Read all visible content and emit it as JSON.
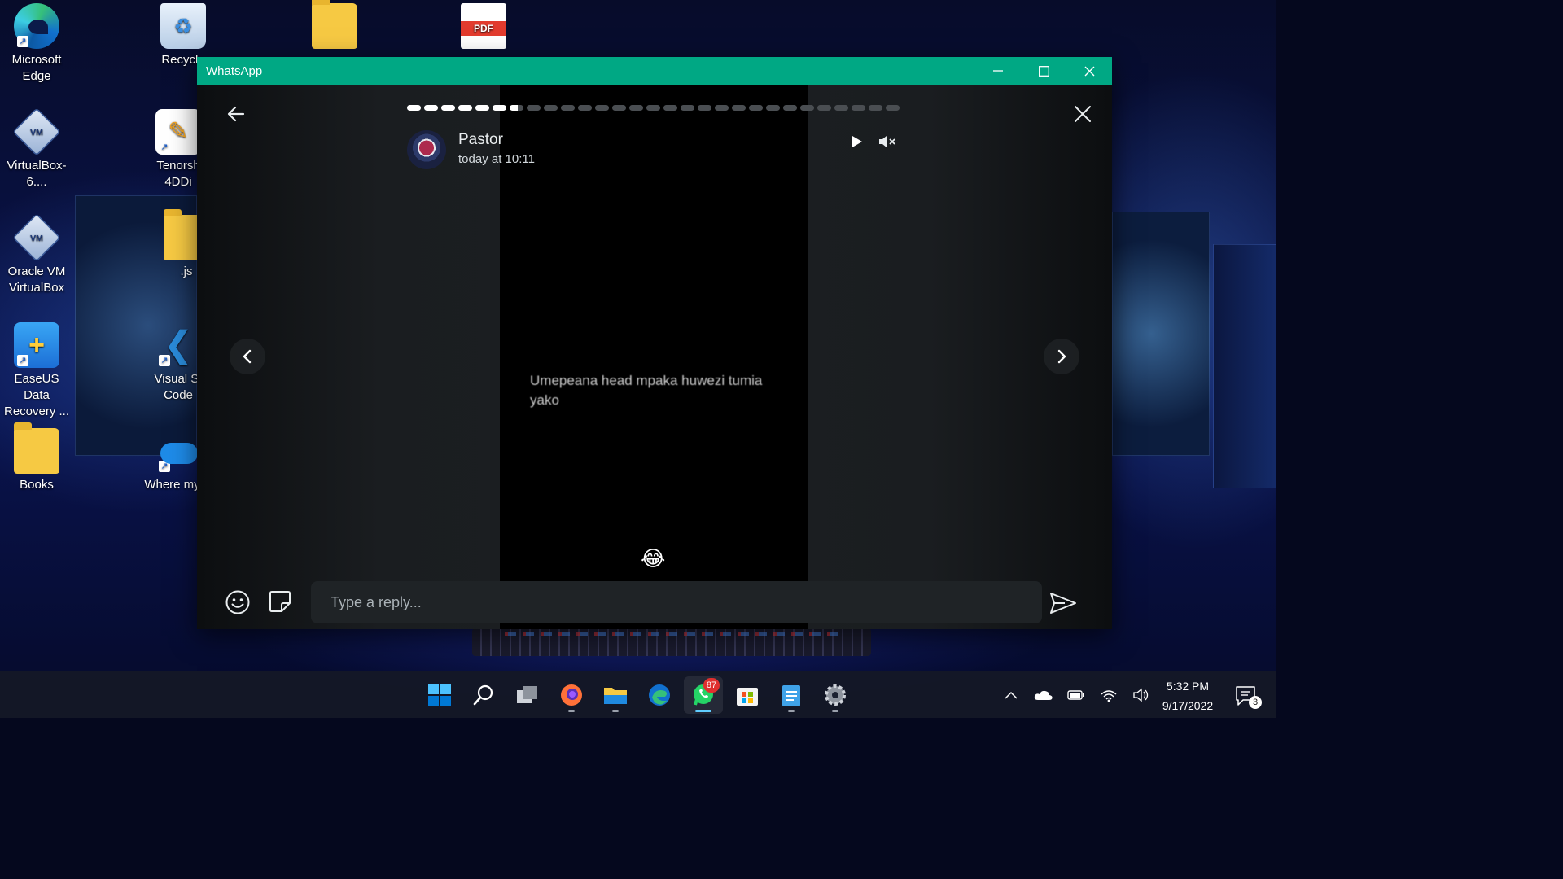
{
  "desktop": {
    "icons": [
      {
        "id": "edge",
        "label": "Microsoft Edge",
        "icon": "edge-icon"
      },
      {
        "id": "recycle",
        "label": "Recycle",
        "icon": "recycle-bin-icon"
      },
      {
        "id": "folder-top",
        "label": "",
        "icon": "folder-icon"
      },
      {
        "id": "pdf",
        "label": "",
        "icon": "pdf-icon"
      },
      {
        "id": "vbox6",
        "label": "VirtualBox-6....",
        "icon": "virtualbox-icon"
      },
      {
        "id": "tenorshare",
        "label": "Tenorsh 4DDi",
        "icon": "tenorshare-icon"
      },
      {
        "id": "oracle-vm",
        "label": "Oracle VM VirtualBox",
        "icon": "virtualbox-icon"
      },
      {
        "id": "js",
        "label": ".js",
        "icon": "folder-icon"
      },
      {
        "id": "easeus",
        "label": "EaseUS Data Recovery ...",
        "icon": "easeus-icon"
      },
      {
        "id": "vscode",
        "label": "Visual St Code",
        "icon": "vscode-icon"
      },
      {
        "id": "books",
        "label": "Books",
        "icon": "folder-icon"
      },
      {
        "id": "where",
        "label": "Where my fil",
        "icon": "onedrive-icon"
      }
    ]
  },
  "window": {
    "title": "WhatsApp",
    "controls": {
      "minimize": "minimize-icon",
      "maximize": "maximize-icon",
      "close": "close-icon"
    }
  },
  "status": {
    "progress": {
      "total": 29,
      "viewed": 6,
      "current_index": 7,
      "current_fraction": 0.6
    },
    "contact_name": "Pastor",
    "timestamp": "today at 10:11",
    "text": "Umepeana head mpaka huwezi tumia yako",
    "reaction_emoji": "😂",
    "reply_placeholder": "Type a reply..."
  },
  "taskbar": {
    "apps": [
      {
        "name": "start-button",
        "icon": "windows-start-icon"
      },
      {
        "name": "search-button",
        "icon": "search-icon"
      },
      {
        "name": "task-view-button",
        "icon": "task-view-icon"
      },
      {
        "name": "firefox-app",
        "icon": "firefox-icon"
      },
      {
        "name": "file-explorer-app",
        "icon": "file-explorer-icon"
      },
      {
        "name": "edge-app",
        "icon": "edge-icon"
      },
      {
        "name": "whatsapp-app",
        "icon": "whatsapp-icon",
        "badge": "87"
      },
      {
        "name": "microsoft-store-app",
        "icon": "store-icon"
      },
      {
        "name": "notepad-app",
        "icon": "notepad-icon"
      },
      {
        "name": "settings-app",
        "icon": "settings-gear-icon"
      }
    ],
    "time": "5:32 PM",
    "date": "9/17/2022",
    "notification_count": "3"
  }
}
